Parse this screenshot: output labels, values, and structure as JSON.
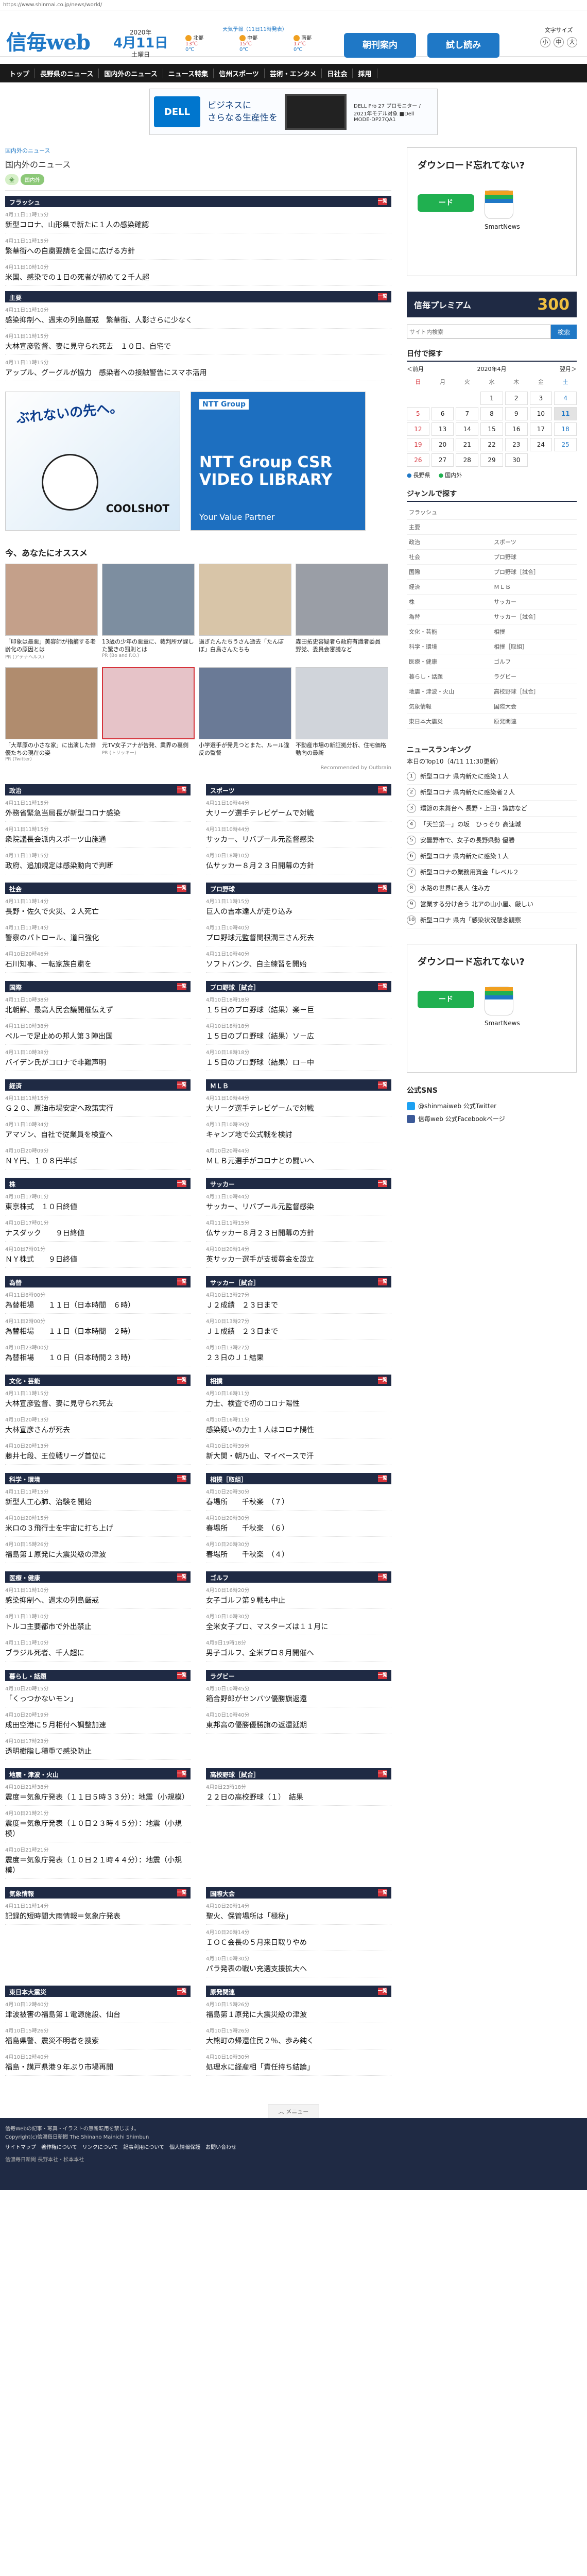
{
  "browser": {
    "url": "https://www.shinmai.co.jp/news/world/"
  },
  "header": {
    "logo": "信毎web",
    "year": "2020年",
    "date": "4月11日",
    "weekday": "土曜日",
    "weather_title": "天気予報（11日11時発表）",
    "cities": [
      {
        "name": "北部",
        "temp": "13℃",
        "sub": "0℃"
      },
      {
        "name": "中部",
        "temp": "15℃",
        "sub": "0℃"
      },
      {
        "name": "南部",
        "temp": "17℃",
        "sub": "0℃"
      }
    ],
    "btn_news": "朝刊案内",
    "btn_trial": "試し読み",
    "fontsize_label": "文字サイズ",
    "fontsize_options": [
      "小",
      "中",
      "大"
    ]
  },
  "nav": [
    "トップ",
    "長野県のニュース",
    "国内外のニュース",
    "ニュース特集",
    "信州スポーツ",
    "芸術・エンタメ",
    "日社会",
    "採用"
  ],
  "ad_top": {
    "brand": "DELL Technologies",
    "headline": "ビジネスに",
    "headline2": "さらなる生産性を",
    "text": "DELL Pro 27 プロモニター / 2021年モデル対象 ■Dell MODE-DP27QA1"
  },
  "breadcrumb": "国内外のニュース",
  "page_title": "国内外のニュース",
  "tags": [
    "全",
    "国内外"
  ],
  "block_flash": {
    "title": "フラッシュ",
    "stories": [
      {
        "time": "4月11日11時15分",
        "headline": "新型コロナ、山形県で新たに１人の感染確認"
      },
      {
        "time": "4月11日11時15分",
        "headline": "繁華街への自粛要請を全国に広げる方針"
      },
      {
        "time": "4月11日10時10分",
        "headline": "米国、感染での１日の死者が初めて２千人超"
      }
    ]
  },
  "block_main": {
    "title": "主要",
    "stories": [
      {
        "time": "4月11日11時10分",
        "headline": "感染抑制へ、週末の列島厳戒　繁華街、人影さらに少なく"
      },
      {
        "time": "4月11日11時15分",
        "headline": "大林宣彦監督、妻に見守られ死去　１０日、自宅で"
      },
      {
        "time": "4月11日11時15分",
        "headline": "アップル、グーグルが協力　感染者への接触警告にスマホ活用"
      }
    ]
  },
  "ads_mid": [
    {
      "big": "ぶれないの先へ。",
      "brand": "COOLSHOT"
    },
    {
      "brand_tag": "NTT Group",
      "big": "NTT Group CSR VIDEO LIBRARY",
      "small": "Your Value Partner"
    }
  ],
  "recommend": {
    "title": "今、あなたにオススメ",
    "items": [
      {
        "cap": "「印象は最悪」美容師が指摘する老齢化の原因とは",
        "src": "PR (アテナヘルス)"
      },
      {
        "cap": "13歳の少年の悪童に、裁判所が課した驚きの罰則とは",
        "src": "PR (Bo and F.O.)"
      },
      {
        "cap": "過ぎたんたちうさん逝去「たんぼぼ」白鳥さんたちも",
        "src": ""
      },
      {
        "cap": "森田拓史容疑者ら政府有識者委員　野党、委員会審議など",
        "src": ""
      },
      {
        "cap": "「大草原の小さな家」に出演した俳優たちの現在の姿",
        "src": "PR (Twitter)"
      },
      {
        "cap": "元TV女子アナが告発、業界の裏側",
        "src": "PR (トリッキー)"
      },
      {
        "cap": "小学選手が発見つとまた、ルール違反の監督",
        "src": ""
      },
      {
        "cap": "不動産市場の新証拠分析、住宅価格動向の最新",
        "src": ""
      }
    ],
    "footer": "Recommended by Outbrain"
  },
  "categories": [
    {
      "title": "政治",
      "stories": [
        {
          "time": "4月11日11時15分",
          "headline": "外務省緊急当局長が新型コロナ感染"
        },
        {
          "time": "4月11日11時15分",
          "headline": "衆院議長会派内スポーツ山施通"
        },
        {
          "time": "4月11日11時15分",
          "headline": "政府、追加規定は感染動向で判断"
        }
      ]
    },
    {
      "title": "スポーツ",
      "stories": [
        {
          "time": "4月11日10時44分",
          "headline": "大リーグ選手テレビゲームで対戦"
        },
        {
          "time": "4月11日10時44分",
          "headline": "サッカー、リバプール元監督感染"
        },
        {
          "time": "4月10日18時10分",
          "headline": "仏サッカー８月２３日開幕の方針"
        }
      ]
    },
    {
      "title": "社会",
      "stories": [
        {
          "time": "4月11日11時14分",
          "headline": "長野・佐久で火災、２人死亡"
        },
        {
          "time": "4月11日11時14分",
          "headline": "警察のパトロール、道日強化"
        },
        {
          "time": "4月10日20時46分",
          "headline": "石川知事、一転家族自粛を"
        }
      ]
    },
    {
      "title": "プロ野球",
      "stories": [
        {
          "time": "4月11日11時15分",
          "headline": "巨人の吉本達人が走り込み"
        },
        {
          "time": "4月11日10時40分",
          "headline": "プロ野球元監督関根潤三さん死去"
        },
        {
          "time": "4月11日10時40分",
          "headline": "ソフトバンク、自主練習を開始"
        }
      ]
    },
    {
      "title": "国際",
      "stories": [
        {
          "time": "4月11日10時38分",
          "headline": "北朝鮮、最高人民会議開催伝えず"
        },
        {
          "time": "4月11日10時38分",
          "headline": "ペルーで足止めの邦人第３陣出国"
        },
        {
          "time": "4月11日10時38分",
          "headline": "バイデン氏がコロナで非難声明"
        }
      ]
    },
    {
      "title": "プロ野球［試合］",
      "stories": [
        {
          "time": "4月10日18時18分",
          "headline": "１５日のプロ野球（結果）楽－巨"
        },
        {
          "time": "4月10日18時18分",
          "headline": "１５日のプロ野球（結果）ソ－広"
        },
        {
          "time": "4月10日18時18分",
          "headline": "１５日のプロ野球（結果）ロ－中"
        }
      ]
    },
    {
      "title": "経済",
      "stories": [
        {
          "time": "4月11日11時15分",
          "headline": "Ｇ２０、原油市場安定へ政策実行"
        },
        {
          "time": "4月11日10時34分",
          "headline": "アマゾン、自社で従業員を検査へ"
        },
        {
          "time": "4月10日20時09分",
          "headline": "ＮＹ円、１０８円半ば"
        }
      ]
    },
    {
      "title": "ＭＬＢ",
      "stories": [
        {
          "time": "4月11日10時44分",
          "headline": "大リーグ選手テレビゲームで対戦"
        },
        {
          "time": "4月11日10時39分",
          "headline": "キャンプ地で公式戦を検討"
        },
        {
          "time": "4月10日20時44分",
          "headline": "ＭＬＢ元選手がコロナとの闘いへ"
        }
      ]
    },
    {
      "title": "株",
      "stories": [
        {
          "time": "4月10日17時01分",
          "headline": "東京株式　１０日終値"
        },
        {
          "time": "4月10日17時01分",
          "headline": "ナスダック　　９日終値"
        },
        {
          "time": "4月10日7時01分",
          "headline": "ＮＹ株式　　９日終値"
        }
      ]
    },
    {
      "title": "サッカー",
      "stories": [
        {
          "time": "4月11日10時44分",
          "headline": "サッカー、リバプール元監督感染"
        },
        {
          "time": "4月11日11時15分",
          "headline": "仏サッカー８月２３日開幕の方針"
        },
        {
          "time": "4月10日20時14分",
          "headline": "英サッカー選手が支援募金を設立"
        }
      ]
    },
    {
      "title": "為替",
      "stories": [
        {
          "time": "4月11日6時00分",
          "headline": "為替相場　　１１日（日本時間　６時）"
        },
        {
          "time": "4月11日2時00分",
          "headline": "為替相場　　１１日（日本時間　２時）"
        },
        {
          "time": "4月10日23時00分",
          "headline": "為替相場　　１０日（日本時間２３時）"
        }
      ]
    },
    {
      "title": "サッカー［試合］",
      "stories": [
        {
          "time": "4月10日13時27分",
          "headline": "Ｊ２成績　２３日まで"
        },
        {
          "time": "4月10日13時27分",
          "headline": "Ｊ１成績　２３日まで"
        },
        {
          "time": "4月10日13時27分",
          "headline": "２３日のＪ１結果"
        }
      ]
    },
    {
      "title": "文化・芸能",
      "stories": [
        {
          "time": "4月11日11時15分",
          "headline": "大林宣彦監督、妻に見守られ死去"
        },
        {
          "time": "4月10日20時13分",
          "headline": "大林宣彦さんが死去"
        },
        {
          "time": "4月10日20時13分",
          "headline": "藤井七段、王位戦リーグ首位に"
        }
      ]
    },
    {
      "title": "相撲",
      "stories": [
        {
          "time": "4月10日16時11分",
          "headline": "力士、検査で初のコロナ陽性"
        },
        {
          "time": "4月10日16時11分",
          "headline": "感染疑いの力士１人はコロナ陽性"
        },
        {
          "time": "4月10日10時39分",
          "headline": "新大関・朝乃山、マイペースで汗"
        }
      ]
    },
    {
      "title": "科学・環境",
      "stories": [
        {
          "time": "4月11日11時15分",
          "headline": "新型人工心肺、治験を開始"
        },
        {
          "time": "4月10日20時15分",
          "headline": "米ロの３飛行士を宇宙に打ち上げ"
        },
        {
          "time": "4月10日15時26分",
          "headline": "福島第１原発に大震災級の津波"
        }
      ]
    },
    {
      "title": "相撲［取組］",
      "stories": [
        {
          "time": "4月10日20時30分",
          "headline": "春場所　　千秋楽　（７）"
        },
        {
          "time": "4月10日20時30分",
          "headline": "春場所　　千秋楽　（６）"
        },
        {
          "time": "4月10日20時30分",
          "headline": "春場所　　千秋楽　（４）"
        }
      ]
    },
    {
      "title": "医療・健康",
      "stories": [
        {
          "time": "4月11日11時10分",
          "headline": "感染抑制へ、週末の列島厳戒"
        },
        {
          "time": "4月11日11時10分",
          "headline": "トルコ主要都市で外出禁止"
        },
        {
          "time": "4月11日11時10分",
          "headline": "ブラジル死者、千人超に"
        }
      ]
    },
    {
      "title": "ゴルフ",
      "stories": [
        {
          "time": "4月10日16時20分",
          "headline": "女子ゴルフ第９戦も中止"
        },
        {
          "time": "4月10日10時30分",
          "headline": "全米女子プロ、マスターズは１１月に"
        },
        {
          "time": "4月9日19時18分",
          "headline": "男子ゴルフ、全米プロ８月開催へ"
        }
      ]
    },
    {
      "title": "暮らし・話題",
      "stories": [
        {
          "time": "4月10日20時15分",
          "headline": "「くっつかないモン」"
        },
        {
          "time": "4月10日20時19分",
          "headline": "成田空港に５月相付へ調整加速"
        },
        {
          "time": "4月10日17時23分",
          "headline": "透明樹脂し積重で感染防止"
        }
      ]
    },
    {
      "title": "ラグビー",
      "stories": [
        {
          "time": "4月10日10時45分",
          "headline": "箱合野郎がセンバツ優勝旗返還"
        },
        {
          "time": "4月10日10時40分",
          "headline": "東邦高の優勝優勝旗の返還延期"
        }
      ]
    },
    {
      "title": "地震・津波・火山",
      "stories": [
        {
          "time": "4月10日21時38分",
          "headline": "震度＝気象庁発表（１１日５時３３分）：地震（小規模）"
        },
        {
          "time": "4月10日21時21分",
          "headline": "震度＝気象庁発表（１０日２３時４５分）：地震（小規模）"
        },
        {
          "time": "4月10日21時21分",
          "headline": "震度＝気象庁発表（１０日２１時４４分）：地震（小規模）"
        }
      ]
    },
    {
      "title": "高校野球［試合］",
      "stories": [
        {
          "time": "4月9日23時18分",
          "headline": "２２日の高校野球（１）　結果"
        }
      ]
    },
    {
      "title": "気象情報",
      "stories": [
        {
          "time": "4月11日11時14分",
          "headline": "記録的短時間大雨情報＝気象庁発表"
        }
      ]
    },
    {
      "title": "国際大会",
      "stories": [
        {
          "time": "4月10日20時14分",
          "headline": "聖火、保管場所は「極秘」"
        },
        {
          "time": "4月10日20時14分",
          "headline": "ＩＯＣ会長の５月来日取りやめ"
        },
        {
          "time": "4月10日10時30分",
          "headline": "パラ発表の戦い充選支援拡大へ"
        }
      ]
    },
    {
      "title": "東日本大震災",
      "stories": [
        {
          "time": "4月10日12時40分",
          "headline": "津波被害の福島第１電源施設、仙台"
        },
        {
          "time": "4月10日15時26分",
          "headline": "福島県警、震災不明者を捜索"
        },
        {
          "time": "4月10日12時40分",
          "headline": "福島・講戸県港９年ぶり市場再開"
        }
      ]
    },
    {
      "title": "原発関連",
      "stories": [
        {
          "time": "4月10日15時26分",
          "headline": "福島第１原発に大震災級の津波"
        },
        {
          "time": "4月10日15時26分",
          "headline": "大熊町の帰還住民２％、歩み鈍く"
        },
        {
          "time": "4月10日10時30分",
          "headline": "処理水に経産相「責任持ち結論」"
        }
      ]
    }
  ],
  "side": {
    "ad_question": "ダウンロード忘れてない?",
    "ad_button": "ード",
    "ad_app_label": "SmartNews",
    "banner_text": "信毎プレミアム",
    "banner_num": "300",
    "search_placeholder": "サイト内検索",
    "search_button": "検索",
    "cal_title": "日付で探す",
    "cal_prev": "＜前月",
    "cal_month": "2020年4月",
    "cal_next": "翌月＞",
    "cal_head": [
      "日",
      "月",
      "火",
      "水",
      "木",
      "金",
      "土"
    ],
    "cal_days": [
      "",
      "",
      "",
      "1",
      "2",
      "3",
      "4",
      "5",
      "6",
      "7",
      "8",
      "9",
      "10",
      "11",
      "12",
      "13",
      "14",
      "15",
      "16",
      "17",
      "18",
      "19",
      "20",
      "21",
      "22",
      "23",
      "24",
      "25",
      "26",
      "27",
      "28",
      "29",
      "30",
      "",
      ""
    ],
    "cal_legend": [
      "長野県",
      "国内外"
    ],
    "genre_title": "ジャンルで探す",
    "genres": [
      "フラッシュ",
      "",
      "主要",
      "",
      "政治",
      "スポーツ",
      "社会",
      "プロ野球",
      "国際",
      "プロ野球［試合］",
      "経済",
      "ＭＬＢ",
      "株",
      "サッカー",
      "為替",
      "サッカー［試合］",
      "文化・芸能",
      "相撲",
      "科学・環境",
      "相撲［取組］",
      "医療・健康",
      "ゴルフ",
      "暮らし・話題",
      "ラグビー",
      "地震・津波・火山",
      "高校野球［試合］",
      "気象情報",
      "国際大会",
      "東日本大震災",
      "原発関連"
    ],
    "rank_title": "ニュースランキング",
    "rank_sub": "本日のTop10（4/11 11:30更新）",
    "rank": [
      "新型コロナ 県内新たに感染１人",
      "新型コロナ 県内新たに感染者２人",
      "環節の未舞台へ 長野・上田・諏訪など",
      "「天竺第一」の坂　ひっそり 高速城",
      "安曇野市で、女子の長野県勢 優勝",
      "新型コロナ 県内新たに感染１人",
      "新型コロナの業務用資金「レベル２",
      "水路の世界に長人 住み方",
      "営業する分け合う 北アの山小屋、厳しい",
      "新型コロナ 県内「感染状況懸念観察"
    ],
    "sns_title": "公式SNS",
    "sns": [
      "@shinmaiweb 公式Twitter",
      "信毎web 公式Facebookページ"
    ]
  },
  "footer": {
    "menu": "メニュー",
    "line1": "信毎Webの記事・写真・イラストの無断転用を禁じます。",
    "line2": "Copyright(c)信濃毎日新聞 The Shinano Mainichi Shimbun",
    "links": [
      "サイトマップ",
      "著作権について",
      "リンクについて",
      "記事利用について",
      "個人情報保護",
      "お問い合わせ"
    ],
    "copyright": "信濃毎日新聞 長野本社・松本本社"
  }
}
